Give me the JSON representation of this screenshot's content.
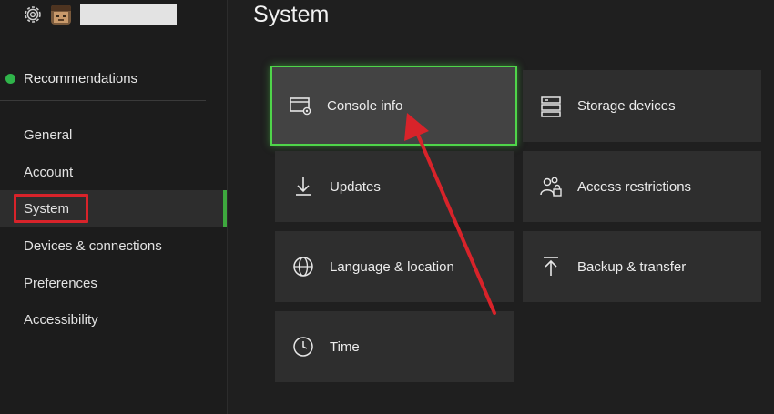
{
  "page": {
    "title": "System"
  },
  "sidebar": {
    "recommendations_label": "Recommendations",
    "items": [
      {
        "label": "General"
      },
      {
        "label": "Account"
      },
      {
        "label": "System"
      },
      {
        "label": "Devices & connections"
      },
      {
        "label": "Preferences"
      },
      {
        "label": "Accessibility"
      }
    ],
    "selected_index": 2
  },
  "tiles": [
    {
      "label": "Console info",
      "icon": "console-info-icon"
    },
    {
      "label": "Storage devices",
      "icon": "storage-devices-icon"
    },
    {
      "label": "Updates",
      "icon": "download-arrow-icon"
    },
    {
      "label": "Access restrictions",
      "icon": "people-lock-icon"
    },
    {
      "label": "Language & location",
      "icon": "globe-icon"
    },
    {
      "label": "Backup & transfer",
      "icon": "upload-arrow-icon"
    },
    {
      "label": "Time",
      "icon": "clock-icon"
    }
  ],
  "colors": {
    "focus_border": "#4fd54a",
    "nav_accent": "#3ea83e",
    "annotation_red": "#d8232a"
  }
}
